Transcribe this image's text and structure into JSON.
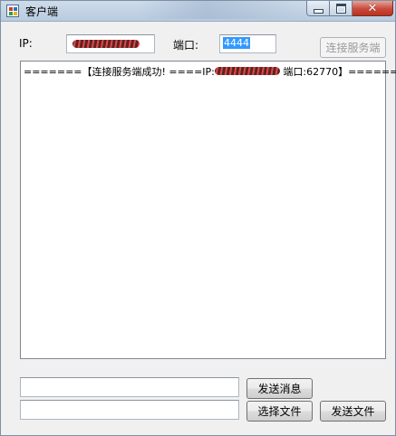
{
  "window": {
    "title": "客户端",
    "icon": "application-icon",
    "controls": [
      "minimize-icon",
      "maximize-icon",
      "close-icon"
    ],
    "close_symbol": "✕"
  },
  "connection": {
    "ip_label": "IP:",
    "ip_value": "",
    "port_label": "端口:",
    "port_value": "4444",
    "connect_button": "连接服务端"
  },
  "log": {
    "prefix": "=======【连接服务端成功! ====IP:",
    "suffix": " 端口:62770】======="
  },
  "send": {
    "message_value": "",
    "send_message_button": "发送消息",
    "file_value": "",
    "choose_file_button": "选择文件",
    "send_file_button": "发送文件"
  },
  "colors": {
    "selection": "#3399ff",
    "close_button": "#c9493b",
    "window_bg": "#f0f0f0"
  }
}
